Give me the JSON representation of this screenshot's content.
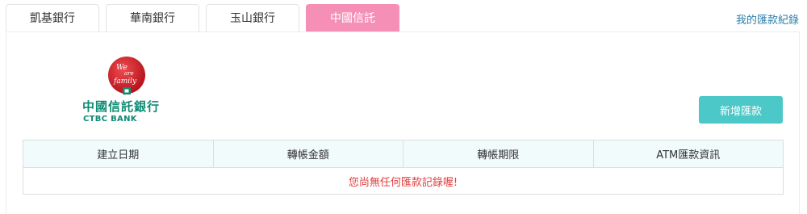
{
  "tabs": [
    {
      "label": "凱基銀行",
      "active": false
    },
    {
      "label": "華南銀行",
      "active": false
    },
    {
      "label": "玉山銀行",
      "active": false
    },
    {
      "label": "中國信託",
      "active": true
    }
  ],
  "record_link": "我的匯款紀錄",
  "logo": {
    "name": "中國信託銀行",
    "subtitle": "CTBC BANK",
    "emblem_text": [
      "We",
      "are",
      "family"
    ]
  },
  "add_button": "新增匯款",
  "table": {
    "headers": [
      "建立日期",
      "轉帳金額",
      "轉帳期限",
      "ATM匯款資訊"
    ],
    "empty_message": "您尚無任何匯款記錄喔!"
  },
  "colors": {
    "active_tab": "#f58fb6",
    "button": "#4cc8c8",
    "brand_green": "#0e8b73",
    "emblem_red": "#d31f28",
    "link": "#2c7fa8",
    "empty_text": "#e23c3c"
  }
}
